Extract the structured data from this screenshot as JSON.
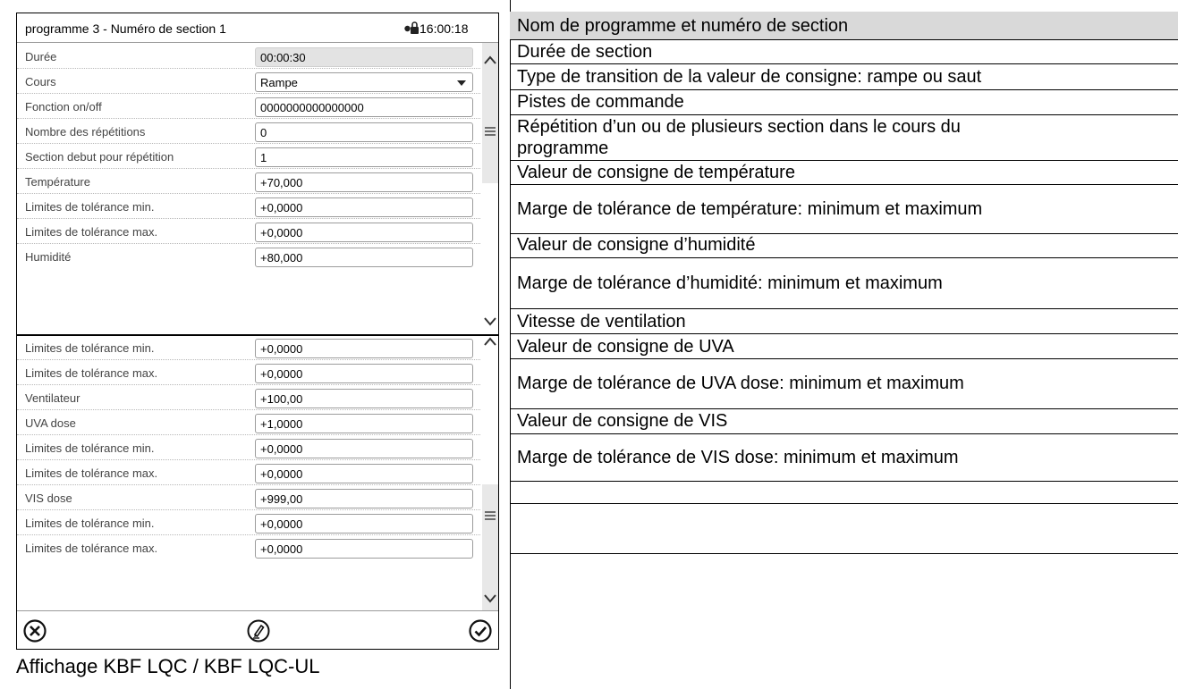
{
  "screen": {
    "title": "programme 3 - Numéro de section 1",
    "time": "16:00:18",
    "rows_top": [
      {
        "label": "Durée",
        "value": "00:00:30"
      },
      {
        "label": "Cours",
        "value": "Rampe"
      },
      {
        "label": "Fonction on/off",
        "value": "0000000000000000"
      },
      {
        "label": "Nombre des répétitions",
        "value": "0"
      },
      {
        "label": "Section debut pour répétition",
        "value": "1"
      },
      {
        "label": "Température",
        "value": "+70,000"
      },
      {
        "label": "Limites de tolérance min.",
        "value": "+0,0000"
      },
      {
        "label": "Limites de tolérance max.",
        "value": "+0,0000"
      },
      {
        "label": "Humidité",
        "value": "+80,000"
      }
    ],
    "rows_bottom": [
      {
        "label": "Limites de tolérance min.",
        "value": "+0,0000"
      },
      {
        "label": "Limites de tolérance max.",
        "value": "+0,0000"
      },
      {
        "label": "Ventilateur",
        "value": "+100,00"
      },
      {
        "label": "UVA dose",
        "value": "+1,0000"
      },
      {
        "label": "Limites de tolérance min.",
        "value": "+0,0000"
      },
      {
        "label": "Limites de tolérance max.",
        "value": "+0,0000"
      },
      {
        "label": "VIS dose",
        "value": "+999,00"
      },
      {
        "label": "Limites de tolérance min.",
        "value": "+0,0000"
      },
      {
        "label": "Limites de tolérance max.",
        "value": "+0,0000"
      }
    ],
    "icons": {
      "lock": "lock-icon",
      "scroll_up": "chevron-up-icon",
      "scroll_down": "chevron-down-icon",
      "scroll_handle": "menu-handle-icon",
      "cancel": "cancel-icon",
      "edit": "edit-icon",
      "confirm": "check-icon"
    }
  },
  "caption": "Affichage KBF LQC / KBF LQC-UL",
  "descriptions": [
    "Nom de programme et numéro de section",
    "Durée de section",
    "Type de transition de la valeur de consigne: rampe ou saut",
    "Pistes de commande",
    "Répétition d’un ou de plusieurs section dans le cours du",
    "programme",
    "Valeur de consigne de température",
    "Marge de tolérance de température: minimum et maximum",
    "Valeur de consigne d’humidité",
    "Marge de tolérance d’humidité: minimum et maximum",
    "Vitesse de ventilation",
    "Valeur de consigne de UVA",
    "Marge de tolérance de UVA dose: minimum et maximum",
    "Valeur de consigne de VIS",
    "Marge de tolérance de VIS dose: minimum et maximum"
  ],
  "colors": {
    "header_shade": "#d9d9d9",
    "readonly_field": "#e3e3e3",
    "scrollbar": "#e8e8e8"
  }
}
